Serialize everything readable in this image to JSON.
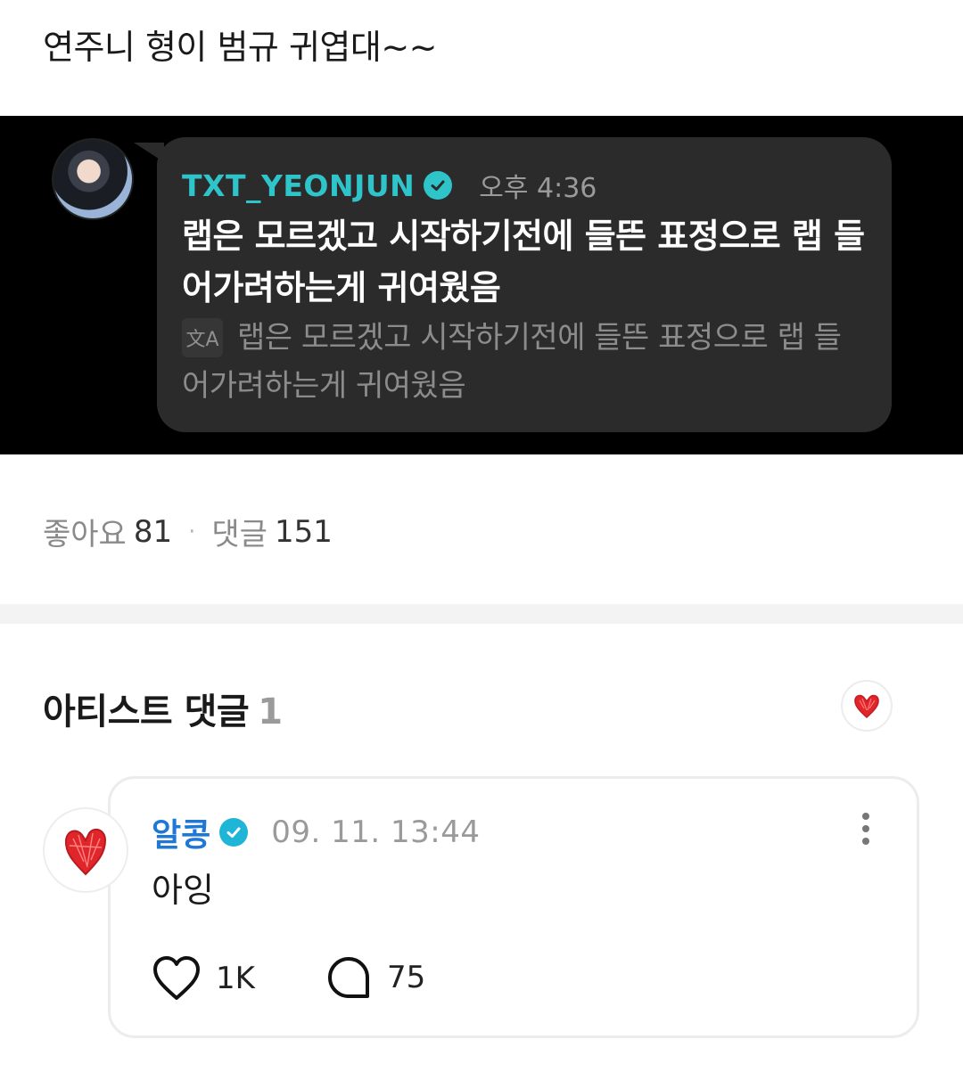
{
  "post": {
    "text": "연주니 형이 범규 귀엽대~~"
  },
  "screenshot": {
    "username": "TXT_YEONJUN",
    "time": "오후 4:36",
    "message": "랩은 모르겠고 시작하기전에 들뜬 표정으로 랩 들어가려하는게 귀여웠음",
    "translate_icon_label": "文A",
    "translation": "랩은 모르겠고 시작하기전에 들뜬 표정으로 랩 들어가려하는게 귀여웠음"
  },
  "stats": {
    "likes_label": "좋아요",
    "likes": "81",
    "separator": "·",
    "comments_label": "댓글",
    "comments": "151"
  },
  "artist_comments": {
    "title": "아티스트 댓글",
    "count": "1"
  },
  "comment": {
    "author": "알콩",
    "date": "09. 11. 13:44",
    "text": "아잉",
    "likes": "1K",
    "replies": "75"
  },
  "colors": {
    "accent_teal": "#2ec4c9",
    "author_blue": "#1f77d6",
    "heart_red": "#e0262b"
  },
  "icons": [
    "verified-badge-icon",
    "translate-icon",
    "heart-filter-icon",
    "heart-avatar-icon",
    "more-options-icon",
    "heart-outline-icon",
    "comment-bubble-icon"
  ]
}
